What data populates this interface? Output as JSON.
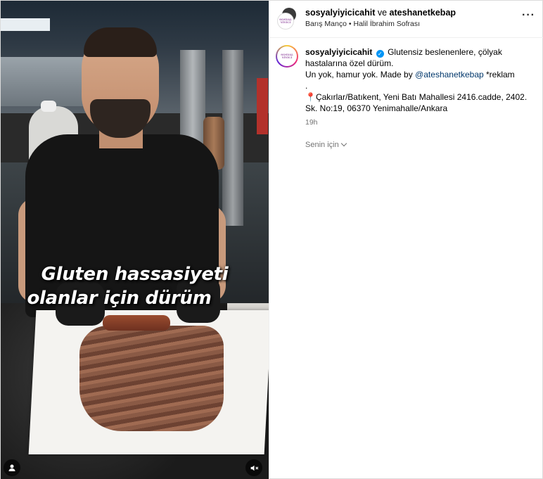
{
  "header": {
    "user1": "sosyalyiyicicahit",
    "joiner": "ve",
    "user2": "ateshanetkebap",
    "audio": "Barış Manço",
    "separator": "•",
    "location": "Halil İbrahim Sofrası",
    "more_icon": "more-horizontal-icon"
  },
  "video": {
    "overlay_line1": "Gluten hassasiyeti",
    "overlay_line2": "olanlar için dürüm",
    "user_tag_icon": "user-icon",
    "mute_icon": "speaker-muted-icon"
  },
  "post": {
    "username": "sosyalyiyicicahit",
    "verified_glyph": "✓",
    "text_line1": "Glutensiz beslenenlere, çölyak hastalarına özel dürüm.",
    "text_line2_a": "Un yok, hamur yok. Made by ",
    "mention": "@ateshanetkebap",
    "text_line2_b": " *reklam",
    "dot": ".",
    "pin": "📍",
    "address": "Çakırlar/Batıkent, Yeni Batı Mahallesi 2416.cadde, 2402. Sk. No:19, 06370 Yenimahalle/Ankara",
    "time": "19h",
    "for_you": "Senin için"
  },
  "logo_text": "SOSYAL YİYİCİ"
}
